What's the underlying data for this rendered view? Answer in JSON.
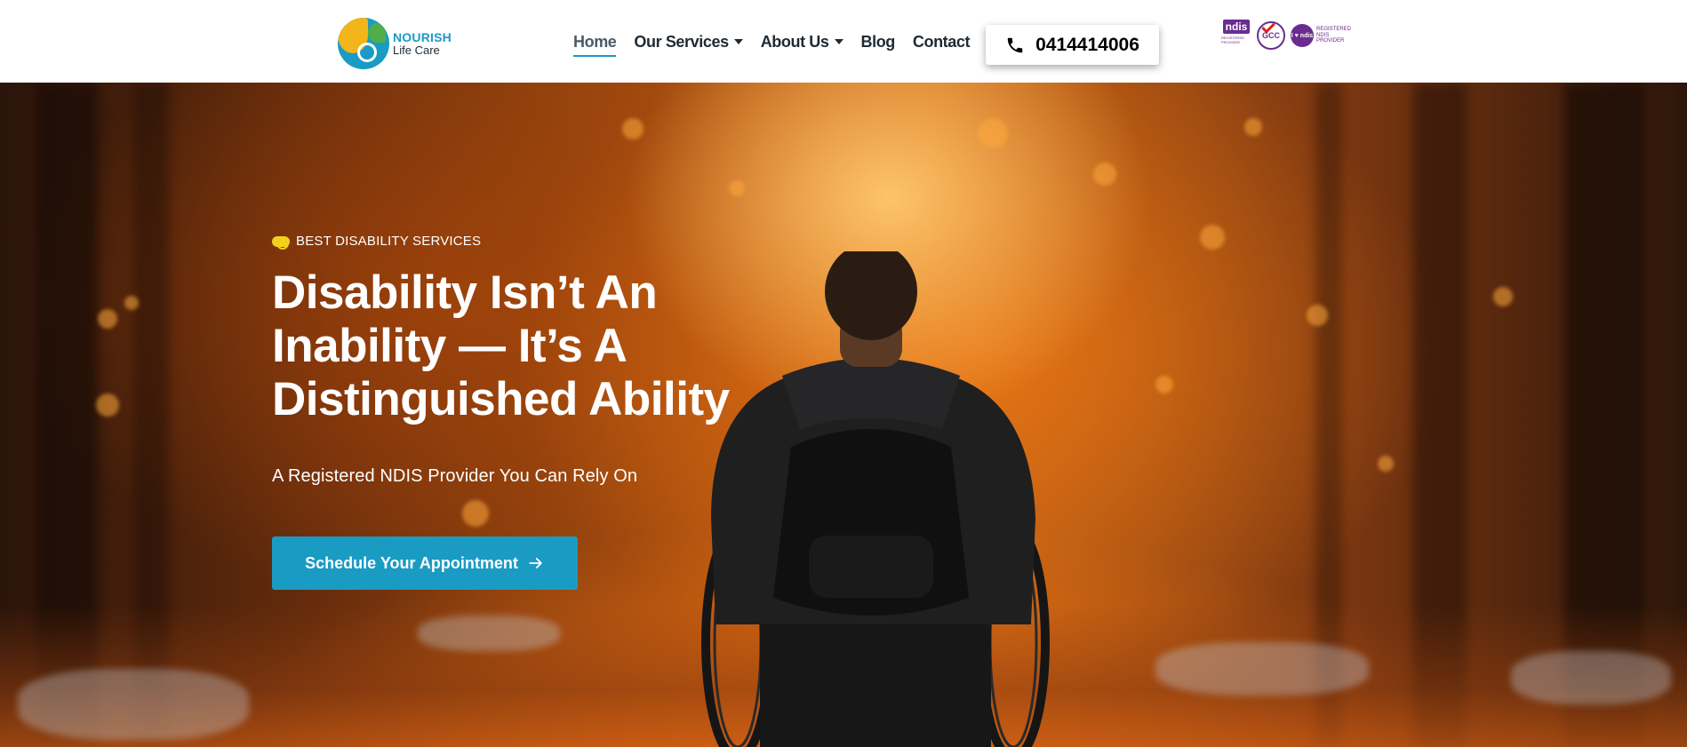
{
  "header": {
    "logo": {
      "name": "NOURISH",
      "sub": "Life Care"
    },
    "nav": [
      {
        "label": "Home",
        "active": true,
        "dropdown": false
      },
      {
        "label": "Our Services",
        "active": false,
        "dropdown": true
      },
      {
        "label": "About Us",
        "active": false,
        "dropdown": true
      },
      {
        "label": "Blog",
        "active": false,
        "dropdown": false
      },
      {
        "label": "Contact",
        "active": false,
        "dropdown": false
      }
    ],
    "phone": "0414414006",
    "phone_icon": "phone-icon",
    "badges": {
      "ndis": {
        "label": "ndis",
        "sub": "REGISTERED PROVIDER"
      },
      "gcc": {
        "label": "GCC"
      },
      "registered": {
        "mark": "I ♥ ndis",
        "text": "REGISTERED NDIS PROVIDER"
      }
    }
  },
  "hero": {
    "eyebrow": "BEST DISABILITY SERVICES",
    "title_lines": [
      "Disability Isn’t An",
      "Inability — It’s A",
      "Distinguished Ability"
    ],
    "subtitle": "A Registered NDIS Provider You Can Rely On",
    "cta_label": "Schedule Your Appointment",
    "cta_icon": "arrow-right-icon"
  },
  "colors": {
    "accent": "#1a9bc4",
    "brand_yellow": "#f2b51a",
    "ndis_purple": "#6a2c8f",
    "text_dark": "#1f2a33"
  }
}
